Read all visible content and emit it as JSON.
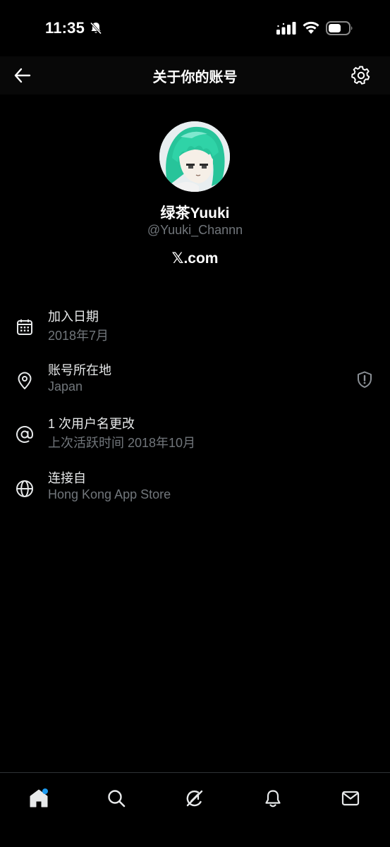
{
  "status_bar": {
    "time": "11:35",
    "icons": [
      "bell-muted-icon",
      "signal-icon",
      "wifi-icon",
      "battery-icon"
    ]
  },
  "header": {
    "title": "关于你的账号",
    "back_icon": "back-arrow-icon",
    "settings_icon": "gear-icon"
  },
  "profile": {
    "display_name": "绿茶Yuuki",
    "handle": "@Yuuki_Channn",
    "site": "𝕏.com"
  },
  "info_items": [
    {
      "icon": "calendar-icon",
      "title": "加入日期",
      "subtitle": "2018年7月"
    },
    {
      "icon": "location-pin-icon",
      "title": "账号所在地",
      "subtitle": "Japan",
      "badge_icon": "shield-alert-icon"
    },
    {
      "icon": "at-sign-icon",
      "title": "1 次用户名更改",
      "subtitle": "上次活跃时间 2018年10月"
    },
    {
      "icon": "globe-icon",
      "title": "连接自",
      "subtitle": "Hong Kong App Store"
    }
  ],
  "bottom_nav": {
    "items": [
      "home-icon",
      "search-icon",
      "grok-icon",
      "notifications-icon",
      "messages-icon"
    ],
    "colors": {
      "notification_dot": "#1d9bf0",
      "background": "#000000",
      "secondary_text": "#71767b"
    }
  }
}
